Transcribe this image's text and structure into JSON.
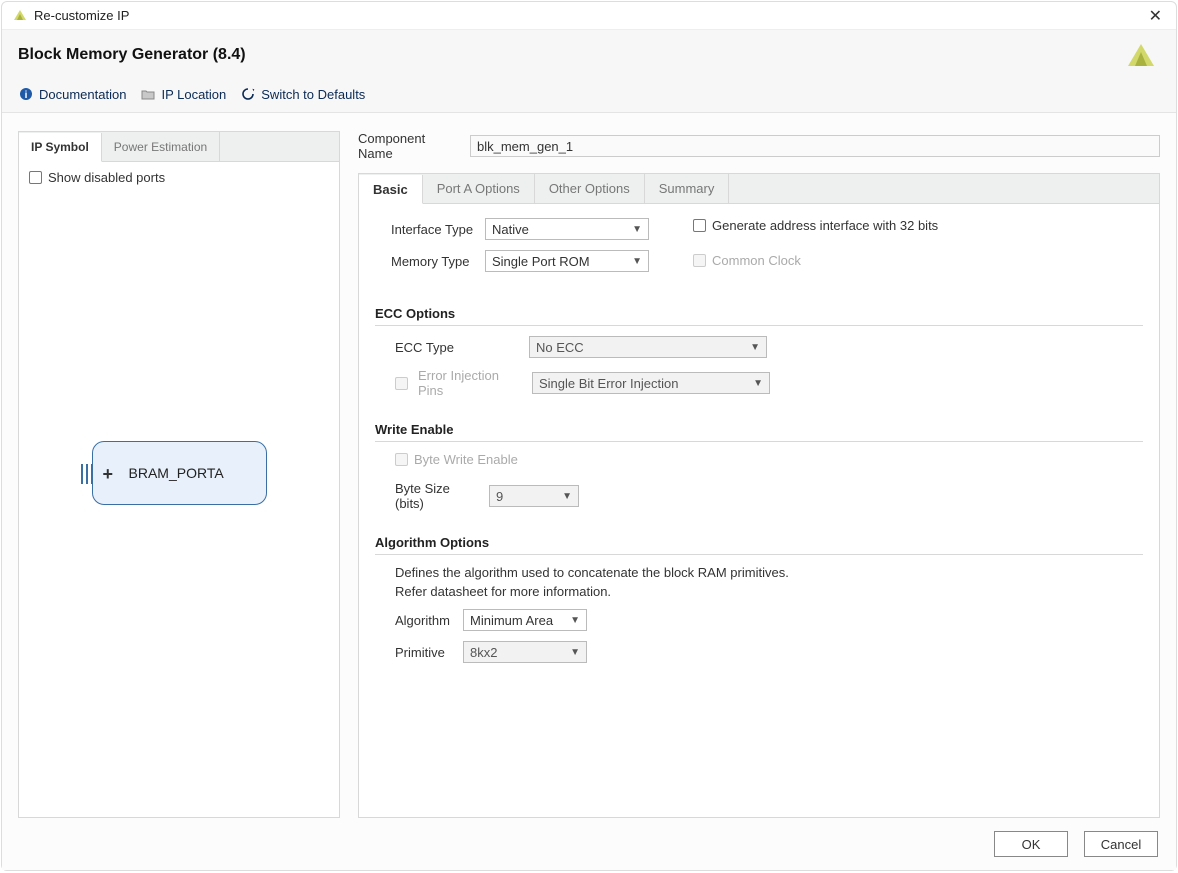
{
  "window": {
    "title": "Re-customize IP",
    "close_glyph": "✕"
  },
  "header": {
    "title": "Block Memory Generator (8.4)"
  },
  "toolbar": {
    "doc": "Documentation",
    "ip_location": "IP Location",
    "defaults": "Switch to Defaults"
  },
  "left": {
    "tabs": [
      "IP Symbol",
      "Power Estimation"
    ],
    "show_disabled": "Show disabled ports",
    "bram_port": "BRAM_PORTA"
  },
  "right": {
    "component_name_label": "Component Name",
    "component_name_value": "blk_mem_gen_1",
    "tabs": [
      "Basic",
      "Port A Options",
      "Other Options",
      "Summary"
    ],
    "interface_type_label": "Interface Type",
    "interface_type_value": "Native",
    "memory_type_label": "Memory Type",
    "memory_type_value": "Single Port ROM",
    "gen_addr_32bit": "Generate address interface with 32 bits",
    "common_clock": "Common Clock",
    "ecc_section": "ECC Options",
    "ecc_type_label": "ECC Type",
    "ecc_type_value": "No ECC",
    "error_inj_label": "Error Injection Pins",
    "error_inj_value": "Single Bit Error Injection",
    "write_enable_section": "Write Enable",
    "byte_write_enable": "Byte Write Enable",
    "byte_size_label": "Byte Size (bits)",
    "byte_size_value": "9",
    "algo_section": "Algorithm Options",
    "algo_desc1": "Defines the algorithm used to concatenate the block RAM primitives.",
    "algo_desc2": "Refer datasheet for more information.",
    "algorithm_label": "Algorithm",
    "algorithm_value": "Minimum Area",
    "primitive_label": "Primitive",
    "primitive_value": "8kx2"
  },
  "footer": {
    "ok": "OK",
    "cancel": "Cancel"
  }
}
